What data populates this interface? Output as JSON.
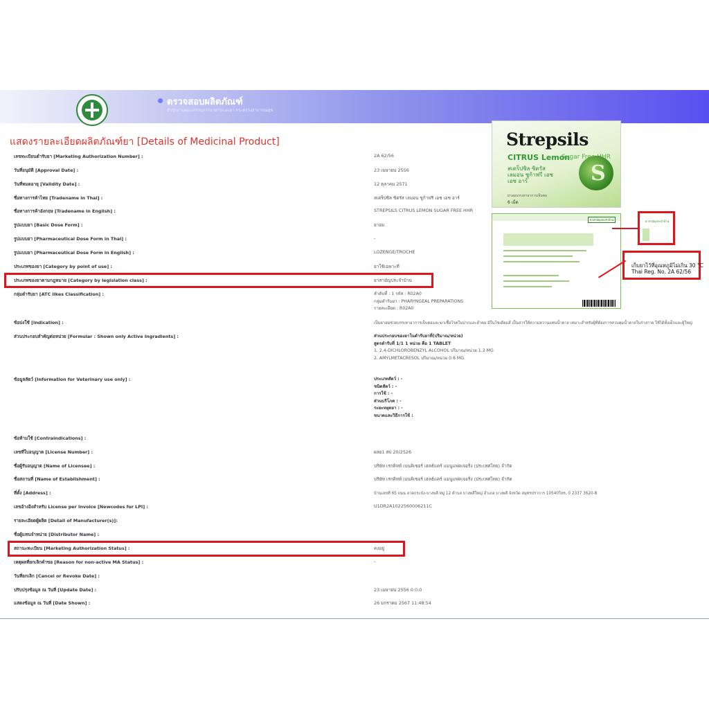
{
  "header": {
    "title": "ตรวจสอบผลิตภัณฑ์",
    "subtitle": "สำนักงานคณะกรรมการอาหารและยา กระทรวงสาธารณสุข"
  },
  "page_title": "แสดงรายละเอียดผลิตภัณฑ์ยา [Details of Medicinal Product]",
  "fields": [
    {
      "label": "เลขทะเบียนตำรับยา [Marketing Authorization Number] :",
      "value": "2A 62/56"
    },
    {
      "label": "วันที่อนุมัติ [Approval Date] :",
      "value": "23 เมษายน 2556"
    },
    {
      "label": "วันที่หมดอายุ [Validity Date] :",
      "value": "12 ตุลาคม 2571"
    },
    {
      "label": "ชื่อทางการค้าไทย [Tradename in Thai] :",
      "value": "สเตร็ปซิล ซิตรัส เลมอน ชูก้าฟรี เอช เอช อาร์"
    },
    {
      "label": "ชื่อทางการค้าอังกฤษ [Tradename in English] :",
      "value": "STREPSILS CITRUS LEMON SUGAR FREE HHR"
    },
    {
      "label": "รูปแบบยา [Basic Dose Form] :",
      "value": "ยาอม"
    },
    {
      "label": "รูปแบบยา [Pharmaceutical Dose Form in Thai] :",
      "value": "-"
    },
    {
      "label": "รูปแบบยา [Pharmaceutical Dose Form in English] :",
      "value": "LOZENGE/TROCHE"
    },
    {
      "label": "ประเภทของยา [Category by point of use] :",
      "value": "ยาใช้เฉพาะที่"
    },
    {
      "label": "ประเภทของยาตามกฎหมาย [Category by legislation class] :",
      "value": "ยาสามัญประจำบ้าน"
    },
    {
      "label": "กลุ่มตำรับยา [ATC likes Classification] :",
      "value": ""
    },
    {
      "label": "ข้อบ่งใช้ [Indication] :",
      "value": "เป็นยาอมช่วยบรรเทาอาการเจ็บคอและฆ่าเชื้อโรคในปากและลำคอ มีในโซเดียมส์ เป็นสารให้ความหวานแทนน้ำตาล เหมาะสำหรับผู้ที่ต้องการควบคุมน้ำตาลในร่างกาย ใช้ได้ทั้งเด็กและผู้ใหญ่"
    },
    {
      "label": "ส่วนประกอบสำคัญต่อหน่วย [Formular : Shown only Active Ingradients] :",
      "value": ""
    },
    {
      "label": "ข้อมูลสัตว์ [Information for Veterinary use only] :",
      "value": ""
    },
    {
      "label": "ข้อห้ามใช้ [Contraindications] :",
      "value": ""
    },
    {
      "label": "เลขที่ใบอนุญาต [License Number] :",
      "value": "ผลย1 สป 20/2526"
    },
    {
      "label": "ชื่อผู้รับอนุญาต [Name of Licensee] :",
      "value": "บริษัท เรกคิทท์ เบนคิเซอร์ เฮลธ์แคร์ แมนูแฟคเจอริ่ง (ประเทศไทย) จำกัด"
    },
    {
      "label": "ชื่อสถานที่ [Name of Establishment] :",
      "value": "บริษัท เรกคิทท์ เบนคิเซอร์ เฮลธ์แคร์ แมนูแฟคเจอริ่ง (ประเทศไทย) จำกัด"
    },
    {
      "label": "ที่ตั้ง [Address] :",
      "value": "บ้านเลขที่ 65 ถนน ลาดกระบัง-บางพลี หมู่ 12 ตำบล บางพลีใหญ่ อำเภอ บางพลี จังหวัด สมุทรปราการ 10540โทร. 0 2337 3620-8"
    },
    {
      "label": "เลขอ้างอิงสำหรับ License per Invoice [Newcodes for LPI] :",
      "value": "U1DR2A1022560006211C"
    },
    {
      "label": "รายละเอียดผู้ผลิต [Detail of Manufacturer(s)]:",
      "value": ""
    },
    {
      "label": "ชื่อผู้แทนจำหน่าย [Distributor Name] :",
      "value": ""
    },
    {
      "label": "สถานะทะเบียน [Marketing Authorization Status] :",
      "value": "คงอยู่"
    },
    {
      "label": "เหตุผลที่ยกเลิกคำขอ [Reason for non-active MA Status] :",
      "value": "-"
    },
    {
      "label": "วันที่ยกเลิก [Cancel or Revoke Date] :",
      "value": ""
    },
    {
      "label": "ปรับปรุงข้อมูล ณ วันที่ [Update Date] :",
      "value": "23 เมษายน 2556 0:0:0"
    },
    {
      "label": "แสดงข้อมูล ณ วันที่ [Date Shown] :",
      "value": "26 มกราคม 2567 11:48:54"
    }
  ],
  "atc": {
    "level1": "ลำดับที่ : 1 รหัส : R02A0",
    "group": "กลุ่มตำรับยา : PHARYNGEAL PREPARATIONS",
    "detail": "รายละเอียด : R02A0"
  },
  "formula": {
    "heading": "ส่วนประกอบของยาในตำรับยาที่(ปริมาณ/หน่วย)",
    "spec": "สูตรตำรับที่ 1/1  1 หน่วย คือ 1 TABLET",
    "ingredient1": "1. 2,4-DICHLOROBENZYL ALCOHOL       ปริมาณ/หน่วย  1.2 MG",
    "ingredient2": "2. AMYLMETACRESOL       ปริมาณ/หน่วย  0.6 MG"
  },
  "veterinary": {
    "line1": "ประเภทสัตว์ : -",
    "line2": "ชนิดสัตว์ : -",
    "line3": "การใช้ : -",
    "line4": "ส่วนบริโภค : -",
    "line5": "ระยะหยุดยา : -",
    "line6": "ขนาดและวิธีการใช้ :"
  },
  "product_images": {
    "brand": "Strepsils",
    "flavor": "CITRUS Lemon",
    "flavor_suffix": "Sugar Free HHR",
    "thai_brand": "สเตร็ปซิล ซิตรัส เลมอน ชูก้าฟรี เอช เอช อาร์",
    "front_note": "ยาอมบรรเทาอาการเจ็บคอ",
    "front_count": "6 เม็ด",
    "back_tag": "ยาสามัญประจำบ้าน",
    "zoom_tag": "ยาสามัญประจำบ้าน",
    "storage_note": "เก็บยาไว้ที่อุณหภูมิไม่เกิน 30 °C",
    "reg_no": "Thai Reg. No. 2A 62/56"
  },
  "colors": {
    "title_red": "#e0322b",
    "highlight_red": "#e0141b",
    "header_blue": "#5a4ff0",
    "brand_green": "#2f9a33"
  }
}
